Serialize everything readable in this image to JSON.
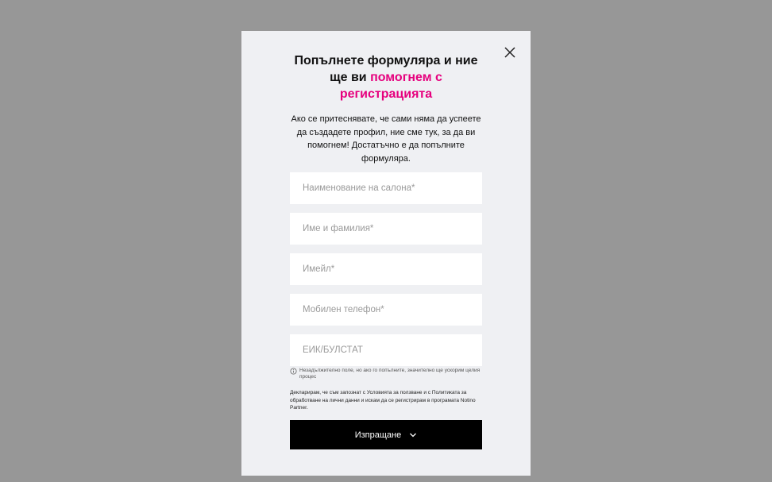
{
  "modal": {
    "title_part1": "Попълнете формуляра и ние ще ви",
    "title_accent": "помогнем с регистрацията",
    "description": "Ако се притеснявате, че сами няма да успеете да създадете профил, ние сме тук, за да ви помогнем! Достатъчно е да попълните формуляра.",
    "fields": {
      "salon_name": {
        "placeholder": "Наименование на салона*",
        "value": ""
      },
      "full_name": {
        "placeholder": "Име и фамилия*",
        "value": ""
      },
      "email": {
        "placeholder": "Имейл*",
        "value": ""
      },
      "phone": {
        "placeholder": "Мобилен телефон*",
        "value": ""
      },
      "eik": {
        "placeholder": "ЕИК/БУЛСТАТ",
        "value": ""
      }
    },
    "hint": "Незадължително поле, но ако го попълните, значително ще ускорим целия процес",
    "legal": "Декларирам, че съм запознат с Условията за ползване и с Политиката за обработване на лични данни и искам да се регистрирам в програмата Notino Partner.",
    "submit_label": "Изпращане",
    "accent_color": "#e6007e",
    "icons": {
      "close": "close-icon",
      "info": "info-icon",
      "submit": "chevron-down-icon"
    }
  }
}
